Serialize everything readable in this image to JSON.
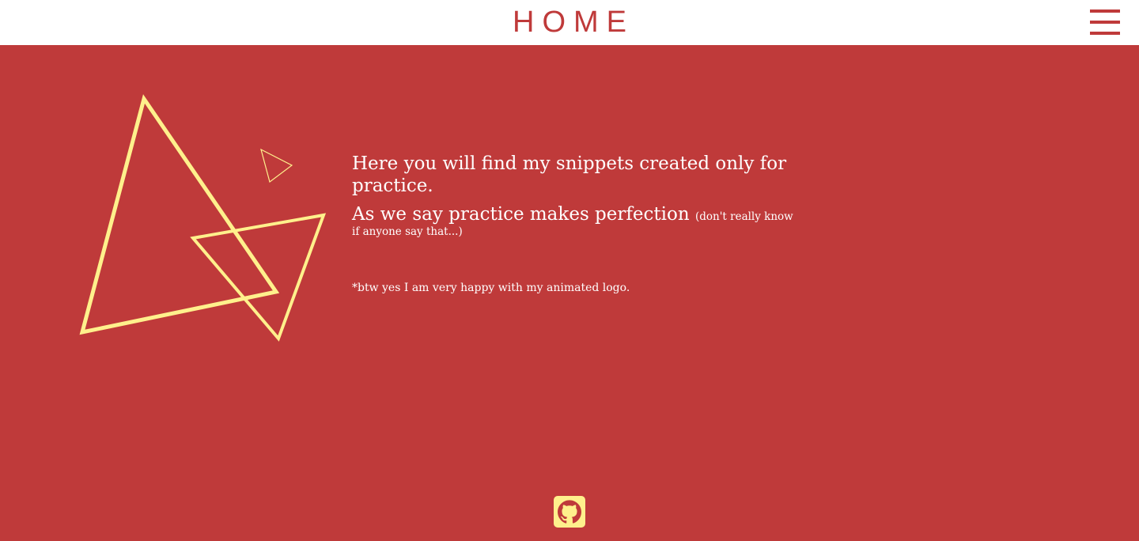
{
  "header": {
    "title": "HOME",
    "menu_icon": "hamburger-menu-icon"
  },
  "main": {
    "intro": "Here you will find my snippets created only for practice.",
    "motto": "As we say practice makes perfection",
    "motto_aside": "(don't really know if anyone say that...)",
    "note": "*btw yes I am very happy with my animated logo."
  },
  "footer": {
    "github_icon": "github-icon"
  },
  "colors": {
    "background": "#bf3a3a",
    "header": "#ffffff",
    "accent": "#fff08c",
    "text": "#ffffff"
  }
}
